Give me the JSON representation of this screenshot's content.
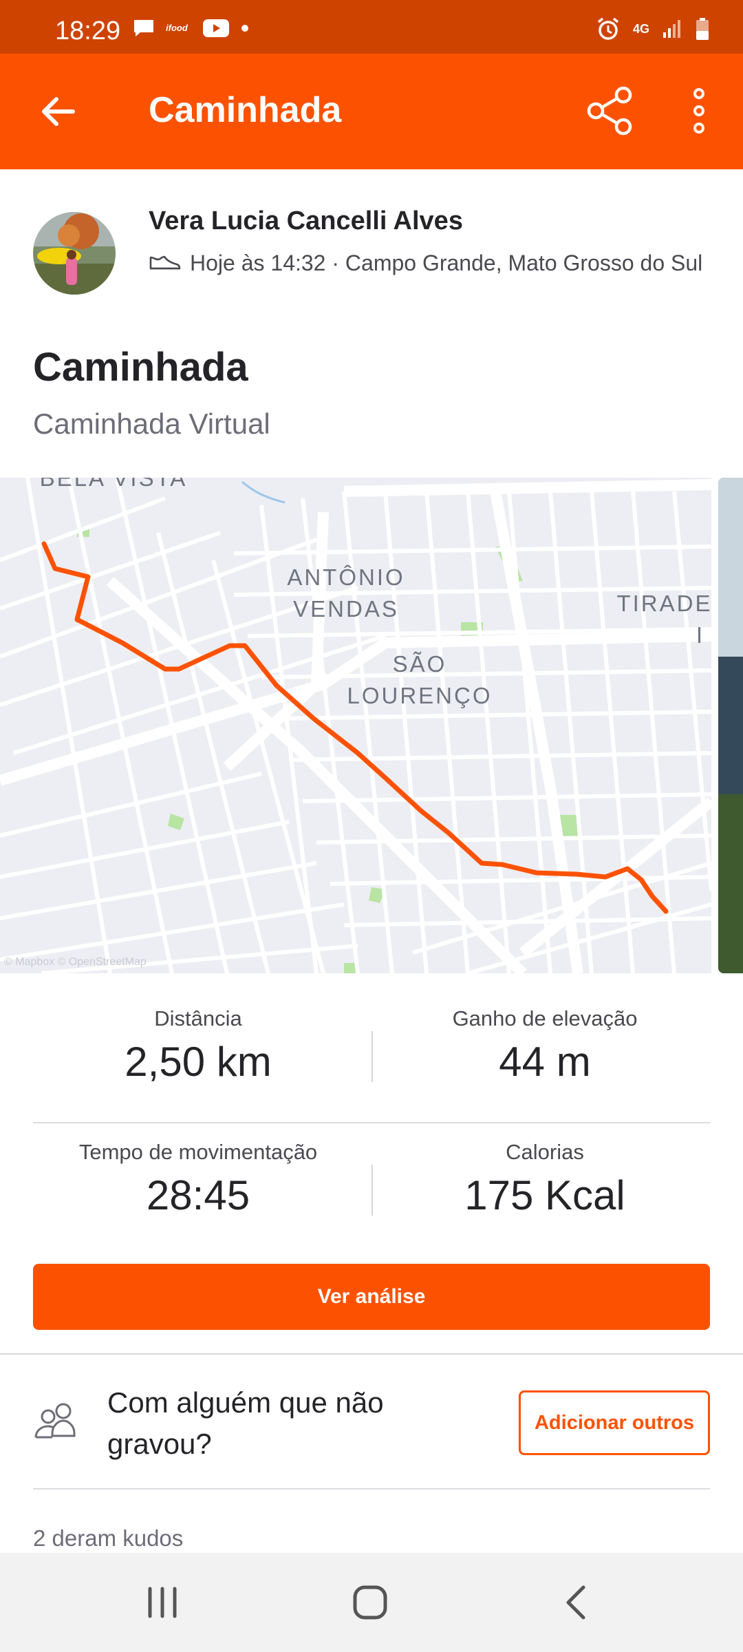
{
  "status_bar": {
    "time": "18:29",
    "network": "4G"
  },
  "app_bar": {
    "title": "Caminhada"
  },
  "athlete": {
    "name": "Vera Lucia Cancelli Alves",
    "meta": "Hoje às 14:32 · Campo Grande, Mato Grosso do Sul"
  },
  "activity": {
    "title": "Caminhada",
    "subtitle": "Caminhada Virtual"
  },
  "map": {
    "labels": {
      "bela_vista": "BELA VISTA",
      "antonio_line1": "ANTÔNIO",
      "antonio_line2": "VENDAS",
      "sao_line1": "SÃO",
      "sao_line2": "LOURENÇO",
      "tirade_line1": "TIRADE",
      "tirade_line2": "I"
    },
    "attribution": "© Mapbox © OpenStreetMap",
    "route_color": "#fc5200"
  },
  "stats": {
    "distance_label": "Distância",
    "distance_value": "2,50 km",
    "elevation_label": "Ganho de elevação",
    "elevation_value": "44 m",
    "moving_time_label": "Tempo de movimentação",
    "moving_time_value": "28:45",
    "calories_label": "Calorias",
    "calories_value": "175 Kcal"
  },
  "actions": {
    "analysis_button": "Ver análise",
    "with_someone_text": "Com alguém que não gravou?",
    "add_others_button": "Adicionar outros"
  },
  "kudos": {
    "text": "2 deram kudos"
  },
  "colors": {
    "brand": "#fc5200",
    "status_bar": "#cf4300"
  }
}
